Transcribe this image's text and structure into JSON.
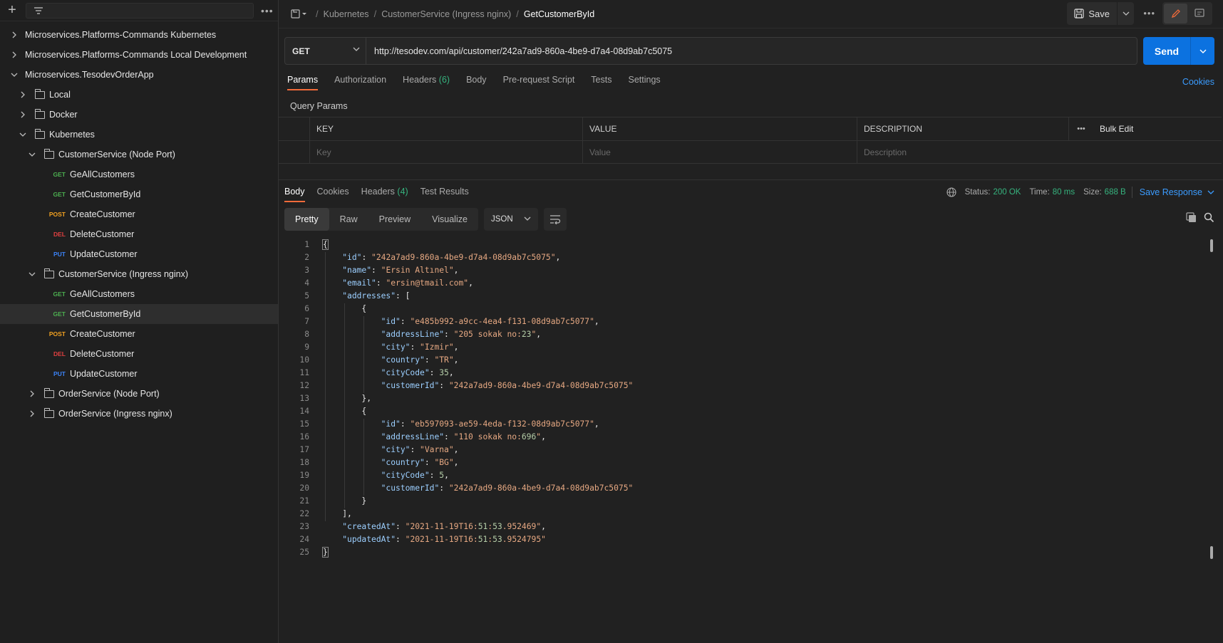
{
  "sidebar": {
    "tree": [
      {
        "label": "Microservices.Platforms-Commands Kubernetes",
        "depth": 0,
        "type": "collection",
        "expanded": false
      },
      {
        "label": "Microservices.Platforms-Commands Local Development",
        "depth": 0,
        "type": "collection",
        "expanded": false
      },
      {
        "label": "Microservices.TesodevOrderApp",
        "depth": 0,
        "type": "collection",
        "expanded": true
      },
      {
        "label": "Local",
        "depth": 1,
        "type": "folder",
        "expanded": false
      },
      {
        "label": "Docker",
        "depth": 1,
        "type": "folder",
        "expanded": false
      },
      {
        "label": "Kubernetes",
        "depth": 1,
        "type": "folder",
        "expanded": true
      },
      {
        "label": "CustomerService (Node Port)",
        "depth": 2,
        "type": "folder",
        "expanded": true
      },
      {
        "label": "GeAllCustomers",
        "depth": 3,
        "type": "request",
        "method": "GET"
      },
      {
        "label": "GetCustomerById",
        "depth": 3,
        "type": "request",
        "method": "GET"
      },
      {
        "label": "CreateCustomer",
        "depth": 3,
        "type": "request",
        "method": "POST"
      },
      {
        "label": "DeleteCustomer",
        "depth": 3,
        "type": "request",
        "method": "DEL"
      },
      {
        "label": "UpdateCustomer",
        "depth": 3,
        "type": "request",
        "method": "PUT"
      },
      {
        "label": "CustomerService (Ingress nginx)",
        "depth": 2,
        "type": "folder",
        "expanded": true
      },
      {
        "label": "GeAllCustomers",
        "depth": 3,
        "type": "request",
        "method": "GET"
      },
      {
        "label": "GetCustomerById",
        "depth": 3,
        "type": "request",
        "method": "GET",
        "selected": true
      },
      {
        "label": "CreateCustomer",
        "depth": 3,
        "type": "request",
        "method": "POST"
      },
      {
        "label": "DeleteCustomer",
        "depth": 3,
        "type": "request",
        "method": "DEL"
      },
      {
        "label": "UpdateCustomer",
        "depth": 3,
        "type": "request",
        "method": "PUT"
      },
      {
        "label": "OrderService (Node Port)",
        "depth": 2,
        "type": "folder",
        "expanded": false
      },
      {
        "label": "OrderService (Ingress nginx)",
        "depth": 2,
        "type": "folder",
        "expanded": false
      }
    ]
  },
  "breadcrumb": {
    "items": [
      "Kubernetes",
      "CustomerService (Ingress nginx)"
    ],
    "current": "GetCustomerById"
  },
  "toolbar": {
    "save_label": "Save"
  },
  "request": {
    "method": "GET",
    "url": "http://tesodev.com/api/customer/242a7ad9-860a-4be9-d7a4-08d9ab7c5075",
    "send_label": "Send",
    "tabs": [
      {
        "label": "Params",
        "active": true
      },
      {
        "label": "Authorization"
      },
      {
        "label": "Headers",
        "count": "(6)"
      },
      {
        "label": "Body"
      },
      {
        "label": "Pre-request Script"
      },
      {
        "label": "Tests"
      },
      {
        "label": "Settings"
      }
    ],
    "cookies_label": "Cookies",
    "query_params_title": "Query Params",
    "table": {
      "headers": [
        "KEY",
        "VALUE",
        "DESCRIPTION"
      ],
      "bulk_edit_label": "Bulk Edit",
      "placeholders": [
        "Key",
        "Value",
        "Description"
      ]
    }
  },
  "response": {
    "tabs": [
      {
        "label": "Body",
        "active": true
      },
      {
        "label": "Cookies"
      },
      {
        "label": "Headers",
        "count": "(4)"
      },
      {
        "label": "Test Results"
      }
    ],
    "status_label": "Status:",
    "status_value": "200 OK",
    "time_label": "Time:",
    "time_value": "80 ms",
    "size_label": "Size:",
    "size_value": "688 B",
    "save_response_label": "Save Response",
    "views": [
      {
        "label": "Pretty",
        "active": true
      },
      {
        "label": "Raw"
      },
      {
        "label": "Preview"
      },
      {
        "label": "Visualize"
      }
    ],
    "format": "JSON",
    "body_lines": [
      "{",
      "    \"id\": \"242a7ad9-860a-4be9-d7a4-08d9ab7c5075\",",
      "    \"name\": \"Ersin Altınel\",",
      "    \"email\": \"ersin@tmail.com\",",
      "    \"addresses\": [",
      "        {",
      "            \"id\": \"e485b992-a9cc-4ea4-f131-08d9ab7c5077\",",
      "            \"addressLine\": \"205 sokak no:23\",",
      "            \"city\": \"Izmir\",",
      "            \"country\": \"TR\",",
      "            \"cityCode\": 35,",
      "            \"customerId\": \"242a7ad9-860a-4be9-d7a4-08d9ab7c5075\"",
      "        },",
      "        {",
      "            \"id\": \"eb597093-ae59-4eda-f132-08d9ab7c5077\",",
      "            \"addressLine\": \"110 sokak no:696\",",
      "            \"city\": \"Varna\",",
      "            \"country\": \"BG\",",
      "            \"cityCode\": 5,",
      "            \"customerId\": \"242a7ad9-860a-4be9-d7a4-08d9ab7c5075\"",
      "        }",
      "    ],",
      "    \"createdAt\": \"2021-11-19T16:51:53.952469\",",
      "    \"updatedAt\": \"2021-11-19T16:51:53.9524795\"",
      "}"
    ]
  },
  "colors": {
    "accent_tab": "#f26b3a",
    "send_button": "#0c72e0",
    "link": "#3b9cff",
    "status_ok": "#36b37e",
    "get": "#4caf50",
    "post": "#f0a020",
    "del": "#e04040",
    "put": "#3b82f6"
  },
  "icons": [
    "plus-icon",
    "filter-icon",
    "more-icon",
    "chevron-right-icon",
    "chevron-down-icon",
    "folder-icon",
    "request-icon",
    "save-icon",
    "edit-icon",
    "comment-icon",
    "globe-icon",
    "copy-icon",
    "search-icon",
    "wrap-icon"
  ]
}
